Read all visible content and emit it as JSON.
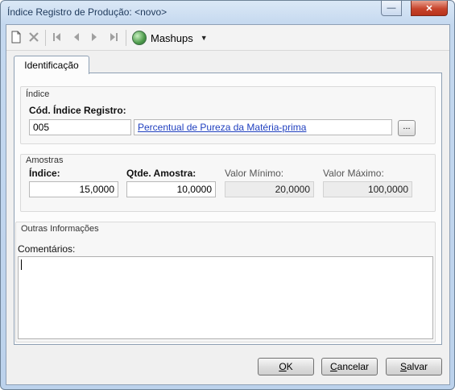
{
  "window": {
    "title": "Índice Registro de Produção: <novo>",
    "close_glyph": "✕"
  },
  "toolbar": {
    "mashups_label": "Mashups",
    "icons": [
      "new-document-icon",
      "delete-icon",
      "first-record-icon",
      "previous-record-icon",
      "next-record-icon",
      "last-record-icon",
      "globe-icon",
      "caret-down-icon"
    ]
  },
  "tabs": [
    {
      "label": "Identificação",
      "active": true
    }
  ],
  "indice_group": {
    "title": "Índice",
    "cod_label": "Cód. Índice Registro:",
    "cod_value": "005",
    "description": "Percentual de Pureza da Matéria-prima",
    "browse_label": "..."
  },
  "amostras_group": {
    "title": "Amostras",
    "indice_label": "Índice:",
    "indice_value": "15,0000",
    "qtde_label": "Qtde. Amostra:",
    "qtde_value": "10,0000",
    "min_label": "Valor Mínimo:",
    "min_value": "20,0000",
    "max_label": "Valor Máximo:",
    "max_value": "100,0000"
  },
  "outras_group": {
    "title": "Outras Informações",
    "comments_label": "Comentários:",
    "comments_value": ""
  },
  "buttons": {
    "ok_prefix": "",
    "ok_underline": "O",
    "ok_rest": "K",
    "cancel_underline": "C",
    "cancel_rest": "ancelar",
    "save_underline": "S",
    "save_rest": "alvar"
  },
  "colors": {
    "link": "#1f3fbf",
    "close_button": "#c7442c",
    "title_text": "#1e395b"
  }
}
